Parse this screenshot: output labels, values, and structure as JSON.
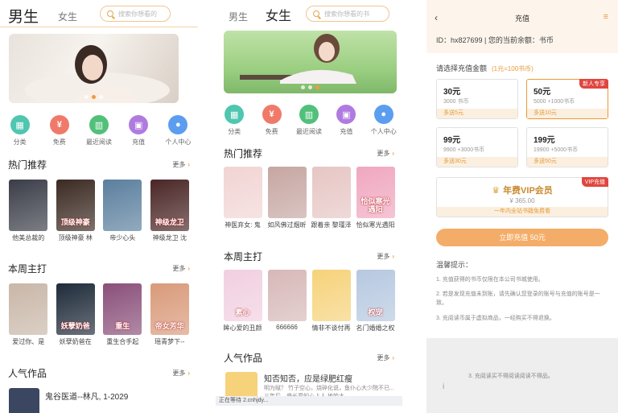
{
  "colors": {
    "accent": "#f0a030",
    "pay": "#f4ad68",
    "tag": "#e0463f"
  },
  "nav_items": [
    {
      "label": "分类",
      "icon": "grid-icon",
      "color": "#4fc6b0"
    },
    {
      "label": "免费",
      "icon": "free-icon",
      "color": "#f07a6a"
    },
    {
      "label": "最近阅读",
      "icon": "books-icon",
      "color": "#52c07a"
    },
    {
      "label": "充值",
      "icon": "lock-icon",
      "color": "#b07be0"
    },
    {
      "label": "个人中心",
      "icon": "user-icon",
      "color": "#5b9ef0"
    }
  ],
  "p1": {
    "tab_active": "男生",
    "tab_other": "女生",
    "search_placeholder": "搜索你想看的",
    "hot": {
      "title": "热门推荐",
      "more": "更多"
    },
    "hot_books": [
      {
        "title": "他美总裁的",
        "cover": "#3a3d48",
        "txt": ""
      },
      {
        "title": "顶级神豪 林",
        "cover": "#3b2a22",
        "txt": "顶级神豪"
      },
      {
        "title": "帝少心头",
        "cover": "#5b7f9e",
        "txt": ""
      },
      {
        "title": "神级龙卫 沈",
        "cover": "#4a2626",
        "txt": "神级龙卫"
      }
    ],
    "week": {
      "title": "本周主打",
      "more": "更多"
    },
    "week_books": [
      {
        "title": "爱过你、是",
        "cover": "#c9b7a8",
        "txt": ""
      },
      {
        "title": "妖孽奶爸在",
        "cover": "#1f2b3a",
        "txt": "妖孽奶爸"
      },
      {
        "title": "重生合手起",
        "cover": "#8a4f7a",
        "txt": "重生"
      },
      {
        "title": "瑶青梦下--",
        "cover": "#d99a7a",
        "txt": "帝女芳华"
      }
    ],
    "popular": {
      "title": "人气作品",
      "more": "更多"
    },
    "popular_book": "鬼谷医道--林凡, 1-2029"
  },
  "p2": {
    "tab_other": "男生",
    "tab_active": "女生",
    "search_placeholder": "搜索你想看的书",
    "hot": {
      "title": "热门推荐",
      "more": "更多"
    },
    "hot_books": [
      {
        "title": "神医弃女: 鬼",
        "cover": "#f2d4d4",
        "txt": ""
      },
      {
        "title": "如风佛过烟昕",
        "cover": "#c6a6a2",
        "txt": ""
      },
      {
        "title": "跟着亲 黎瑾泽",
        "cover": "#e6c6c4",
        "txt": ""
      },
      {
        "title": "恰似寒光遇阳",
        "cover": "#f0a7c0",
        "txt": "恰似寒光遇阳"
      }
    ],
    "week": {
      "title": "本周主打",
      "more": "更多"
    },
    "week_books": [
      {
        "title": "眸心爱的丑颜",
        "cover": "#f1cfe0",
        "txt": "素心"
      },
      {
        "title": "666666",
        "cover": "#d7b8b8",
        "txt": ""
      },
      {
        "title": "情非不谈付再",
        "cover": "#f6d27a",
        "txt": ""
      },
      {
        "title": "名门婚婚之权",
        "cover": "#b6c8e0",
        "txt": "权宠"
      }
    ],
    "popular": {
      "title": "人气作品",
      "more": "更多"
    },
    "popular_book_title": "知否知否，应是绿肥红瘦",
    "popular_book_desc": "明为赋？ 竹子空心，烧碎化说，鱼仆心大少院不已... 三年后，盛长君的心上人 地始大...",
    "status": "正在等待 2.cnhjdy..."
  },
  "p3": {
    "title": "充值",
    "back": "‹",
    "menu": "≡",
    "account": "ID：hx827699 | 您的当前余额：书币",
    "pick_label": "请选择充值金额",
    "pick_hint": "(1元=100书币)",
    "options": [
      {
        "price": "30元",
        "coins": "3000 书币",
        "gift": "多送5元",
        "tag": ""
      },
      {
        "price": "50元",
        "coins": "5000 +1000书币",
        "gift": "多送10元",
        "tag": "新人专享"
      },
      {
        "price": "99元",
        "coins": "9900 +3000书币",
        "gift": "多送30元",
        "tag": ""
      },
      {
        "price": "199元",
        "coins": "19900 +5000书币",
        "gift": "多送50元",
        "tag": ""
      }
    ],
    "vip": {
      "title": "年费VIP会员",
      "price": "¥ 365.00",
      "sub": "一年内全站书籍免费看",
      "tag": "VIP充值"
    },
    "pay_button": "立即充值 50元",
    "tips_title": "温馨提示：",
    "tips": [
      "1. 充值获得的书币仅限在本公司书城使用。",
      "2. 若是发现充值未到账，请先确认您登录的账号与充值的账号是一致。",
      "3. 充阅读币属于虚拟商品，一经购买不得退换。"
    ],
    "grey_text": "3. 充阅读买不得阅读阅读不得品。",
    "grey_mark": "i"
  }
}
